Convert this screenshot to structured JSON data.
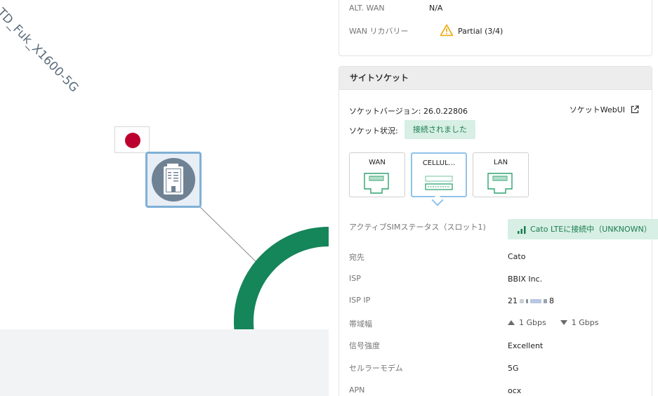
{
  "map": {
    "site_name": "TD_Fuk_X1600-5G",
    "colors": {
      "pop_ring": "#15855a",
      "link": "#8a8a8a",
      "flag_red": "#bc002d"
    }
  },
  "top_card": {
    "alt_wan_label": "ALT. WAN",
    "alt_wan_value": "N/A",
    "wan_recovery_label": "WAN リカバリー",
    "wan_recovery_value": "Partial (3/4)"
  },
  "socket": {
    "header": "サイトソケット",
    "version_label": "ソケットバージョン:",
    "version_value": "26.0.22806",
    "webui_label": "ソケットWebUI",
    "status_label": "ソケット状況:",
    "status_value": "接続されました",
    "ports": [
      {
        "label": "WAN"
      },
      {
        "label": "CELLUL..."
      },
      {
        "label": "LAN"
      }
    ],
    "sim_status_label": "アクティブSIMステータス（スロット1)",
    "sim_status_value": "Cato LTEに接続中（UNKNOWN）",
    "rows": [
      {
        "label": "宛先",
        "value": "Cato"
      },
      {
        "label": "ISP",
        "value": "BBIX Inc."
      },
      {
        "label": "ISP IP",
        "value_start": "21",
        "value_end": "8"
      },
      {
        "label": "帯域幅",
        "up": "1 Gbps",
        "down": "1 Gbps"
      },
      {
        "label": "信号強度",
        "value": "Excellent"
      },
      {
        "label": "セルラーモデム",
        "value": "5G"
      },
      {
        "label": "APN",
        "value": "ocx"
      }
    ]
  }
}
